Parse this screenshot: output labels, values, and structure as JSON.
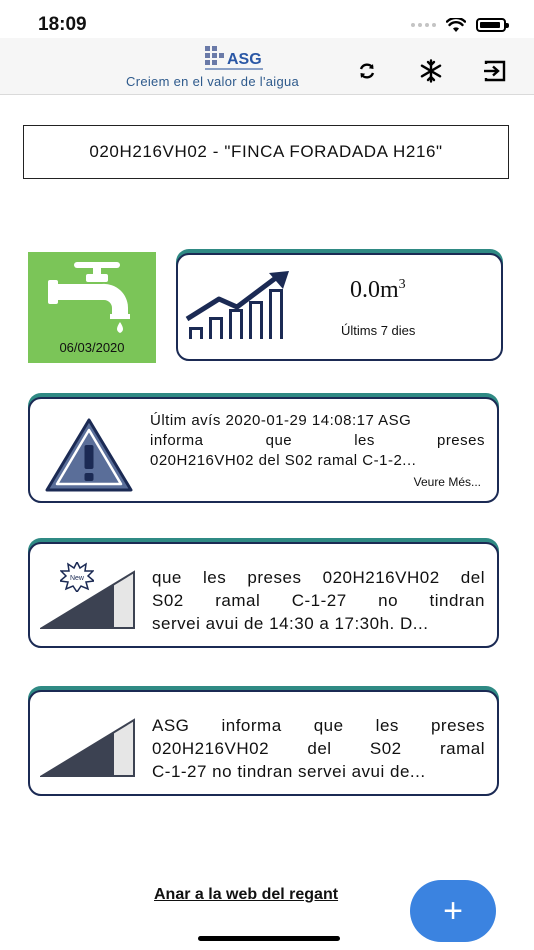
{
  "status_bar": {
    "time": "18:09"
  },
  "header": {
    "brand": "ASG",
    "tagline": "Creiem en el valor de l'aigua",
    "icons": [
      "refresh-icon",
      "snowflake-icon",
      "logout-icon"
    ]
  },
  "meter": {
    "title": "020H216VH02 - \"FINCA FORADADA H216\""
  },
  "tap": {
    "date": "06/03/2020",
    "color": "#7bc558"
  },
  "stats": {
    "volume": "0.0m",
    "volume_unit_sup": "3",
    "period": "Últims 7 dies"
  },
  "alert": {
    "lines": [
      "Últim avís 2020-01-29 14:08:17 ASG",
      "informa que les preses",
      "020H216VH02 del S02 ramal C-1-2..."
    ],
    "more": "Veure Més..."
  },
  "news": [
    {
      "badge": "New",
      "lines": [
        "que les preses 020H216VH02 del",
        "S02 ramal C-1-27 no tindran",
        "servei avui de 14:30 a 17:30h. D..."
      ]
    },
    {
      "lines": [
        "ASG informa que les preses",
        "020H216VH02 del S02 ramal",
        "C-1-27 no tindran servei avui de..."
      ]
    }
  ],
  "footer": {
    "web_link": "Anar a la web del regant",
    "fab_label": "+"
  },
  "colors": {
    "card_border": "#1b2a54",
    "card_accent": "#2f8a84",
    "fab": "#3b83e0",
    "tagline": "#2e5a8c"
  }
}
